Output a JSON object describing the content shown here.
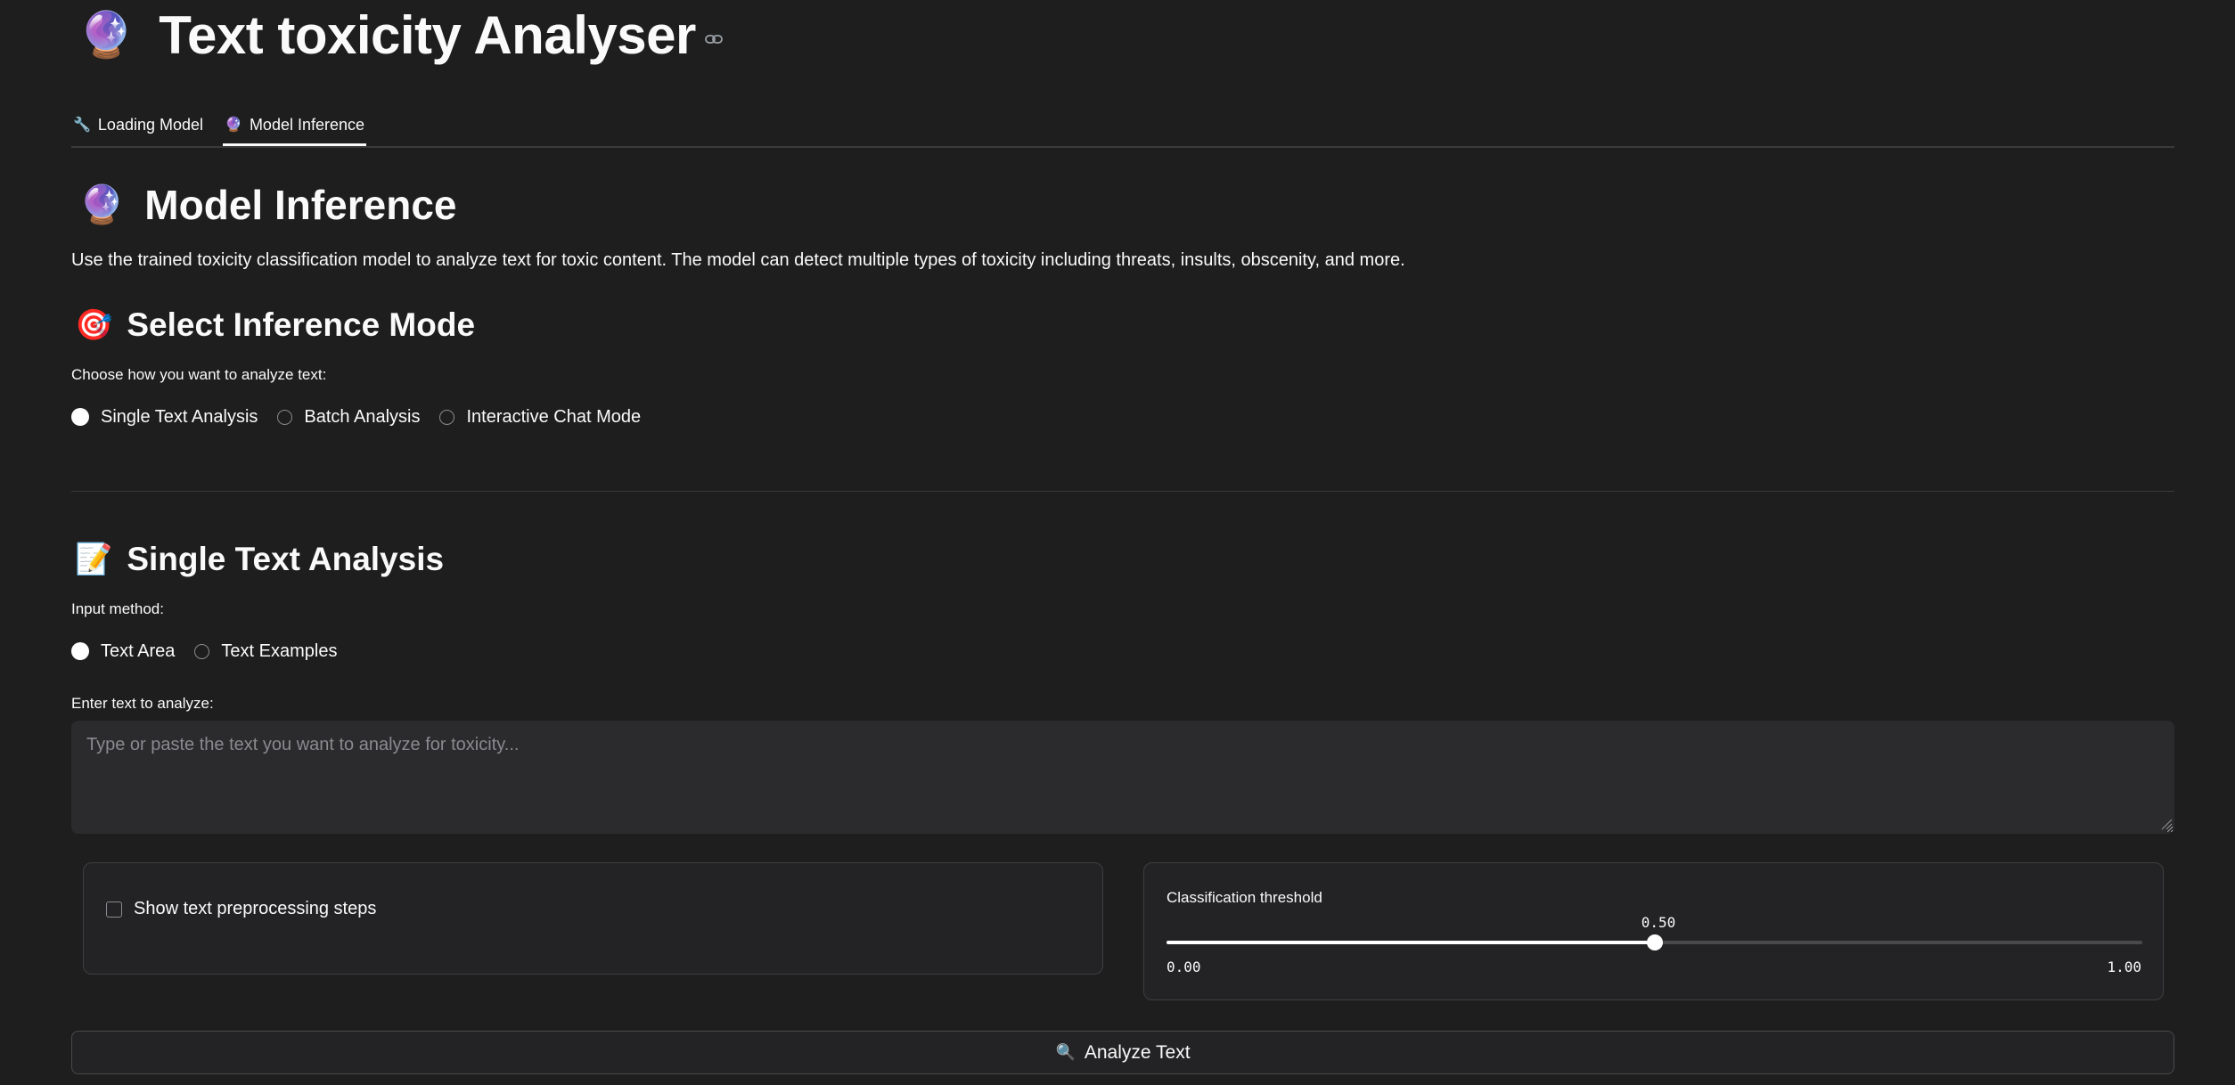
{
  "app": {
    "title": "Text toxicity Analyser",
    "title_icon": "crystal-ball-icon",
    "title_emoji": "🔮",
    "anchor_icon": "link-icon"
  },
  "tabs": [
    {
      "label": "Loading Model",
      "icon": "wrench-icon",
      "emoji": "🔧",
      "active": false
    },
    {
      "label": "Model Inference",
      "icon": "crystal-ball-icon",
      "emoji": "🔮",
      "active": true
    }
  ],
  "inference": {
    "heading": "Model Inference",
    "heading_emoji": "🔮",
    "description": "Use the trained toxicity classification model to analyze text for toxic content. The model can detect multiple types of toxicity including threats, insults, obscenity, and more."
  },
  "mode": {
    "heading": "Select Inference Mode",
    "heading_emoji": "🎯",
    "label": "Choose how you want to analyze text:",
    "options": [
      "Single Text Analysis",
      "Batch Analysis",
      "Interactive Chat Mode"
    ],
    "selected": "Single Text Analysis"
  },
  "single": {
    "heading": "Single Text Analysis",
    "heading_emoji": "📝",
    "input_method_label": "Input method:",
    "input_methods": [
      "Text Area",
      "Text Examples"
    ],
    "selected_method": "Text Area",
    "enter_label": "Enter text to analyze:",
    "placeholder": "Type or paste the text you want to analyze for toxicity...",
    "value": ""
  },
  "options": {
    "preprocess_label": "Show text preprocessing steps",
    "preprocess_checked": false,
    "threshold_label": "Classification threshold",
    "threshold_value": "0.50",
    "threshold_fraction": 0.5,
    "threshold_min": "0.00",
    "threshold_max": "1.00"
  },
  "analyze_button": {
    "label": "Analyze Text",
    "icon": "magnifier-icon",
    "emoji": "🔍"
  },
  "colors": {
    "background": "#1e1e1e",
    "text": "#fafafa",
    "input_background": "#2b2b2d",
    "border": "#3f3f42"
  }
}
